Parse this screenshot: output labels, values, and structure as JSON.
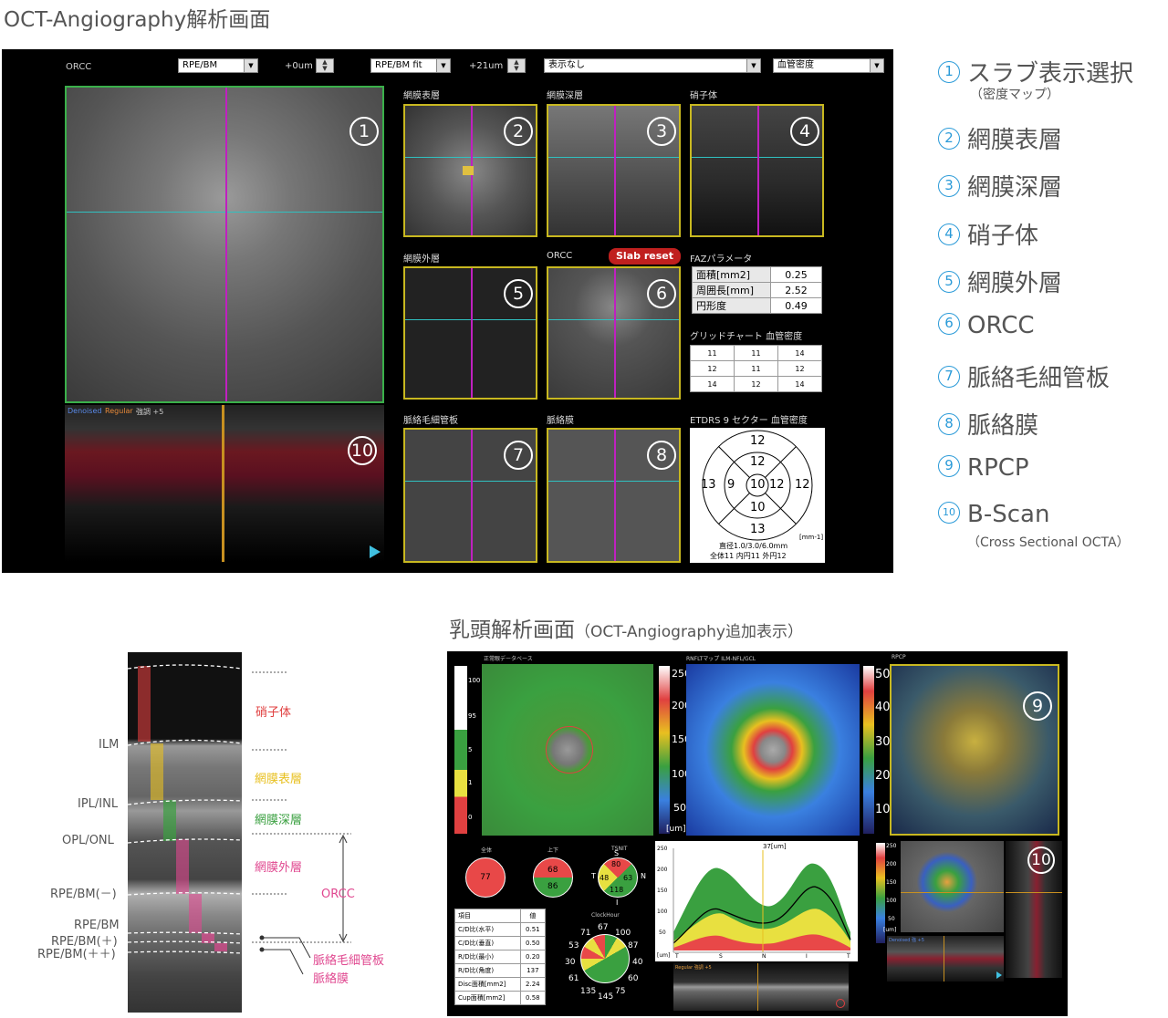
{
  "heading_top": "OCT-Angiography解析画面",
  "toolbar": {
    "top_label": "ORCC",
    "sel1": "RPE/BM",
    "offset1": "+0um",
    "sel2": "RPE/BM fit",
    "offset2": "+21um",
    "sel3": "表示なし",
    "sel4": "血管密度"
  },
  "panels": {
    "p2": "網膜表層",
    "p3": "網膜深層",
    "p4": "硝子体",
    "p5": "網膜外層",
    "p6": "ORCC",
    "p7": "脈絡毛細管板",
    "p8": "脈絡膜",
    "slab_reset": "Slab reset",
    "bscan_label_a": "Denoised",
    "bscan_label_b": "Regular",
    "bscan_label_c": "強調 +5"
  },
  "faz": {
    "title": "FAZパラメータ",
    "rows": [
      {
        "label": "面積[mm2]",
        "value": "0.25"
      },
      {
        "label": "周囲長[mm]",
        "value": "2.52"
      },
      {
        "label": "円形度",
        "value": "0.49"
      }
    ]
  },
  "grid_chart": {
    "title": "グリッドチャート 血管密度",
    "rows": [
      [
        "11",
        "11",
        "14"
      ],
      [
        "12",
        "11",
        "12"
      ],
      [
        "14",
        "12",
        "14"
      ]
    ]
  },
  "etdrs": {
    "title": "ETDRS 9 セクター 血管密度",
    "center": "10",
    "inner_top": "12",
    "inner_left": "9",
    "inner_right": "12",
    "inner_bottom": "10",
    "outer_top": "12",
    "outer_left": "13",
    "outer_right": "12",
    "outer_bottom": "13",
    "unit": "[mm-1]",
    "footer1": "直径1.0/3.0/6.0mm",
    "footer2": "全体11 内円11 外円12"
  },
  "legend": {
    "items": [
      {
        "num": "1",
        "text": "スラブ表示選択",
        "sub": "（密度マップ）"
      },
      {
        "num": "2",
        "text": "網膜表層"
      },
      {
        "num": "3",
        "text": "網膜深層"
      },
      {
        "num": "4",
        "text": "硝子体"
      },
      {
        "num": "5",
        "text": "網膜外層"
      },
      {
        "num": "6",
        "text": "ORCC"
      },
      {
        "num": "7",
        "text": "脈絡毛細管板"
      },
      {
        "num": "8",
        "text": "脈絡膜"
      },
      {
        "num": "9",
        "text": "RPCP"
      },
      {
        "num": "10",
        "text": "B-Scan",
        "sub": "（Cross Sectional OCTA）"
      }
    ]
  },
  "layers": {
    "left_labels": [
      "ILM",
      "IPL/INL",
      "OPL/ONL",
      "RPE/BM(－)",
      "RPE/BM",
      "RPE/BM(＋)",
      "RPE/BM(＋＋)"
    ],
    "right_labels": [
      "硝子体",
      "網膜表層",
      "網膜深層",
      "網膜外層",
      "ORCC",
      "脈絡毛細管板",
      "脈絡膜"
    ],
    "colors": [
      "#e04040",
      "#e8c020",
      "#3aa040",
      "#e04890",
      "#e04890",
      "#e04890",
      "#e04890"
    ]
  },
  "heading_bottom_main": "乳頭解析画面",
  "heading_bottom_sub": "（OCT-Angiography追加表示）",
  "papilla": {
    "panel1_title": "正常眼データベース",
    "panel2_title": "RNFLTマップ ILM-NFL/GCL",
    "panel3_title": "RPCP",
    "scale1": [
      "100",
      "95",
      "5",
      "1",
      "0"
    ],
    "scale2": [
      "250",
      "200",
      "150",
      "100",
      "50",
      "[um]"
    ],
    "scale3": [
      "50",
      "40",
      "30",
      "20",
      "10"
    ],
    "pie_labels": [
      "全体",
      "上下",
      "TSNIT"
    ],
    "pie_total": "77",
    "pie_sup": "68",
    "pie_inf": "86",
    "tsnit": {
      "S": "80",
      "T": "48",
      "N": "63",
      "I": "118"
    },
    "tsnit_dir": {
      "S": "S",
      "T": "T",
      "N": "N",
      "I": "I"
    },
    "table_head": [
      "項目",
      "値"
    ],
    "table_rows": [
      [
        "C/D比(水平)",
        "0.51"
      ],
      [
        "C/D比(垂直)",
        "0.50"
      ],
      [
        "R/D比(最小)",
        "0.20"
      ],
      [
        "R/D比(角度)",
        "137"
      ],
      [
        "Disc面積[mm2]",
        "2.24"
      ],
      [
        "Cup面積[mm2]",
        "0.58"
      ]
    ],
    "clock_title": "ClockHour",
    "clock_values": [
      "67",
      "100",
      "87",
      "40",
      "60",
      "75",
      "145",
      "135",
      "61",
      "30",
      "53",
      "71"
    ],
    "profile_title": "37[um]",
    "profile_y": [
      "250",
      "200",
      "150",
      "100",
      "50"
    ],
    "profile_x": [
      "T",
      "S",
      "N",
      "I",
      "T"
    ],
    "profile_unit": "[um]",
    "bscan_label": "Regular 強調 +5",
    "rpcp_scale": [
      "250",
      "200",
      "150",
      "100",
      "50",
      "[um]"
    ],
    "rpcp_bscan_label": "Denoised 強 +5"
  },
  "colors": {
    "accent": "#2a9ad8",
    "slab_reset": "#c0201e",
    "panel_bg": "#000000"
  }
}
